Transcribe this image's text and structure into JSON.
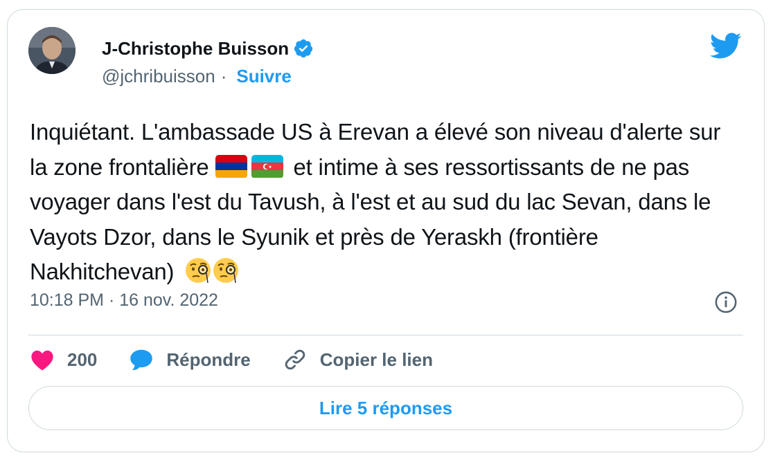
{
  "author": {
    "name": "J-Christophe Buisson",
    "handle": "@jchribuisson",
    "separator": "·",
    "follow_label": "Suivre",
    "verified": true
  },
  "tweet": {
    "text_part1": "Inquiétant. L'ambassade US à Erevan a élevé son niveau d'alerte sur la zone frontalière",
    "text_part2": "et intime à ses ressortissants de ne pas voyager dans l'est du Tavush, à l'est et au sud du lac Sevan, dans le Vayots Dzor, dans le Syunik et près de Yeraskh (frontière Nakhitchevan)",
    "flags": [
      "flag-armenia",
      "flag-azerbaijan"
    ],
    "emojis": [
      "face-with-monocle-icon",
      "face-with-monocle-icon"
    ]
  },
  "meta": {
    "time": "10:18 PM",
    "separator": "·",
    "date": "16 nov. 2022"
  },
  "actions": {
    "like_count": "200",
    "reply_label": "Répondre",
    "copy_label": "Copier le lien"
  },
  "read_replies_label": "Lire 5 réponses",
  "colors": {
    "accent": "#1d9bf0",
    "like": "#f91880",
    "text": "#0f1419",
    "secondary": "#536471",
    "border": "#cfd9de"
  }
}
